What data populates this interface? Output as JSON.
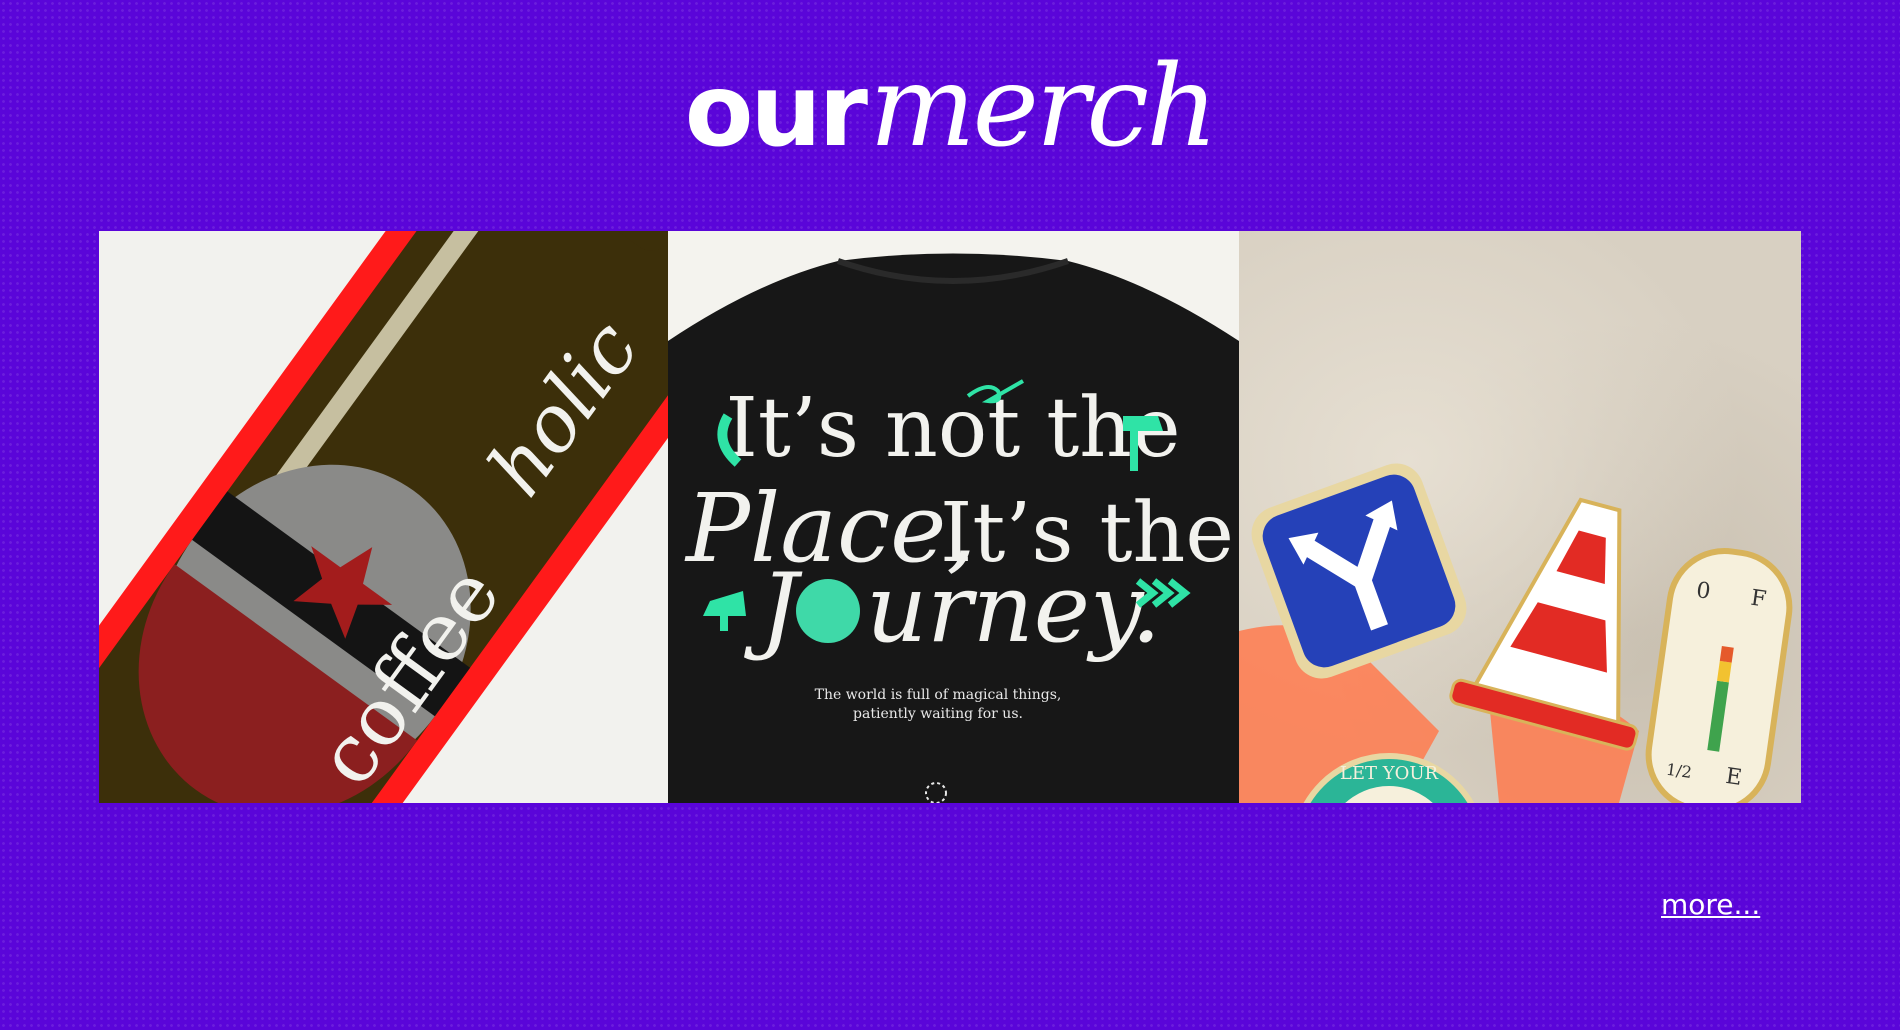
{
  "header": {
    "title_word1": "our",
    "title_word2": "merch"
  },
  "gallery": {
    "items": [
      {
        "artwork_text": [
          "coffee",
          "holic"
        ]
      },
      {
        "headline": [
          "It’s not the",
          "Place,",
          "It’s the",
          "J",
          "urney."
        ],
        "caption_line1": "The world is full of magical things,",
        "caption_line2": "patiently waiting for us."
      },
      {
        "pin_text": "LET YOUR",
        "gauge_labels": [
          "0",
          "F",
          "E",
          "1/2"
        ]
      }
    ]
  },
  "footer": {
    "more_link": "more..."
  },
  "colors": {
    "background": "#5a05d9",
    "accent_green": "#2fe3a6",
    "bottle_red": "#ff1a1a"
  }
}
